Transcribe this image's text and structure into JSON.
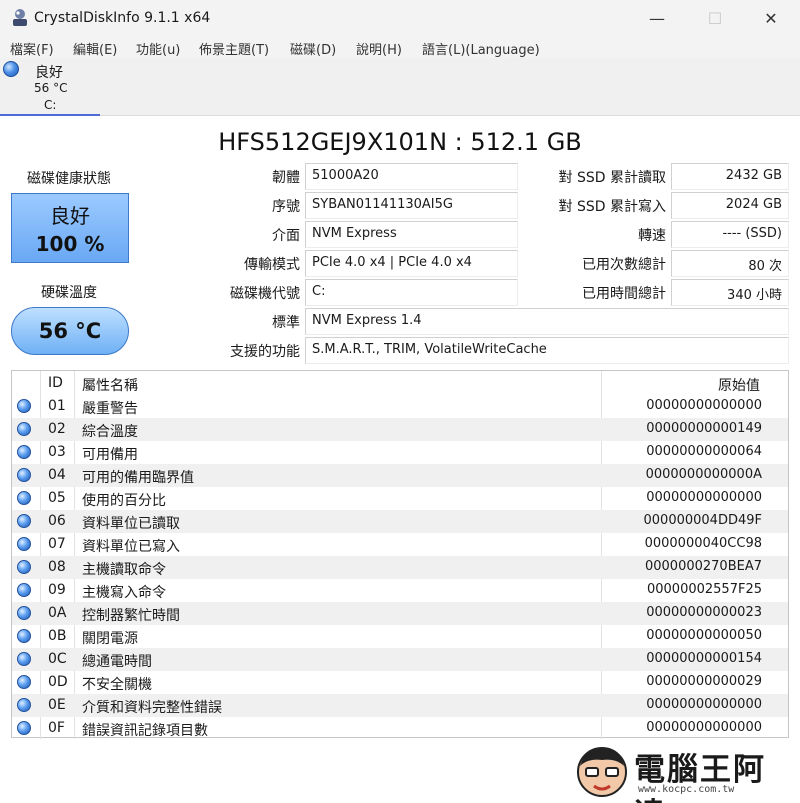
{
  "window": {
    "title": "CrystalDiskInfo 9.1.1 x64",
    "minimize_glyph": "—",
    "maximize_glyph": "☐",
    "close_glyph": "✕"
  },
  "menu": [
    {
      "label": "檔案(F)"
    },
    {
      "label": "編輯(E)"
    },
    {
      "label": "功能(u)"
    },
    {
      "label": "佈景主題(T)"
    },
    {
      "label": "磁碟(D)"
    },
    {
      "label": "說明(H)"
    },
    {
      "label": "語言(L)(Language)"
    }
  ],
  "drive_tab": {
    "status": "良好",
    "temperature": "56 °C",
    "letter": "C:"
  },
  "model": "HFS512GEJ9X101N : 512.1 GB",
  "health": {
    "label": "磁碟健康狀態",
    "status": "良好",
    "percent": "100 %"
  },
  "temperature": {
    "label": "硬碟溫度",
    "value": "56 °C"
  },
  "fields_left": [
    {
      "label": "韌體",
      "value": "51000A20"
    },
    {
      "label": "序號",
      "value": "SYBAN01141130AI5G"
    },
    {
      "label": "介面",
      "value": "NVM Express"
    },
    {
      "label": "傳輸模式",
      "value": "PCIe 4.0 x4 | PCIe 4.0 x4"
    },
    {
      "label": "磁碟機代號",
      "value": "C:"
    }
  ],
  "fields_wide": [
    {
      "label": "標準",
      "value": "NVM Express 1.4"
    },
    {
      "label": "支援的功能",
      "value": "S.M.A.R.T., TRIM, VolatileWriteCache"
    }
  ],
  "fields_right": [
    {
      "label": "對 SSD 累計讀取",
      "value": "2432 GB"
    },
    {
      "label": "對 SSD 累計寫入",
      "value": "2024 GB"
    },
    {
      "label": "轉速",
      "value": "---- (SSD)"
    },
    {
      "label": "已用次數總計",
      "value": "80 次"
    },
    {
      "label": "已用時間總計",
      "value": "340 小時"
    }
  ],
  "smart_table": {
    "headers": {
      "id": "ID",
      "name": "屬性名稱",
      "raw": "原始值"
    },
    "rows": [
      {
        "id": "01",
        "name": "嚴重警告",
        "raw": "00000000000000"
      },
      {
        "id": "02",
        "name": "綜合溫度",
        "raw": "00000000000149"
      },
      {
        "id": "03",
        "name": "可用備用",
        "raw": "00000000000064"
      },
      {
        "id": "04",
        "name": "可用的備用臨界值",
        "raw": "0000000000000A"
      },
      {
        "id": "05",
        "name": "使用的百分比",
        "raw": "00000000000000"
      },
      {
        "id": "06",
        "name": "資料單位已讀取",
        "raw": "000000004DD49F"
      },
      {
        "id": "07",
        "name": "資料單位已寫入",
        "raw": "0000000040CC98"
      },
      {
        "id": "08",
        "name": "主機讀取命令",
        "raw": "0000000270BEA7"
      },
      {
        "id": "09",
        "name": "主機寫入命令",
        "raw": "00000002557F25"
      },
      {
        "id": "0A",
        "name": "控制器繁忙時間",
        "raw": "00000000000023"
      },
      {
        "id": "0B",
        "name": "關閉電源",
        "raw": "00000000000050"
      },
      {
        "id": "0C",
        "name": "總通電時間",
        "raw": "00000000000154"
      },
      {
        "id": "0D",
        "name": "不安全關機",
        "raw": "00000000000029"
      },
      {
        "id": "0E",
        "name": "介質和資料完整性錯誤",
        "raw": "00000000000000"
      },
      {
        "id": "0F",
        "name": "錯誤資訊記錄項目數",
        "raw": "00000000000000"
      }
    ]
  },
  "watermark": {
    "text": "電腦王阿達",
    "url": "www.kocpc.com.tw"
  },
  "colors": {
    "health_good": "#69a8f4",
    "status_dot": "#4d90e6",
    "tab_underline": "#4e6bd6"
  }
}
